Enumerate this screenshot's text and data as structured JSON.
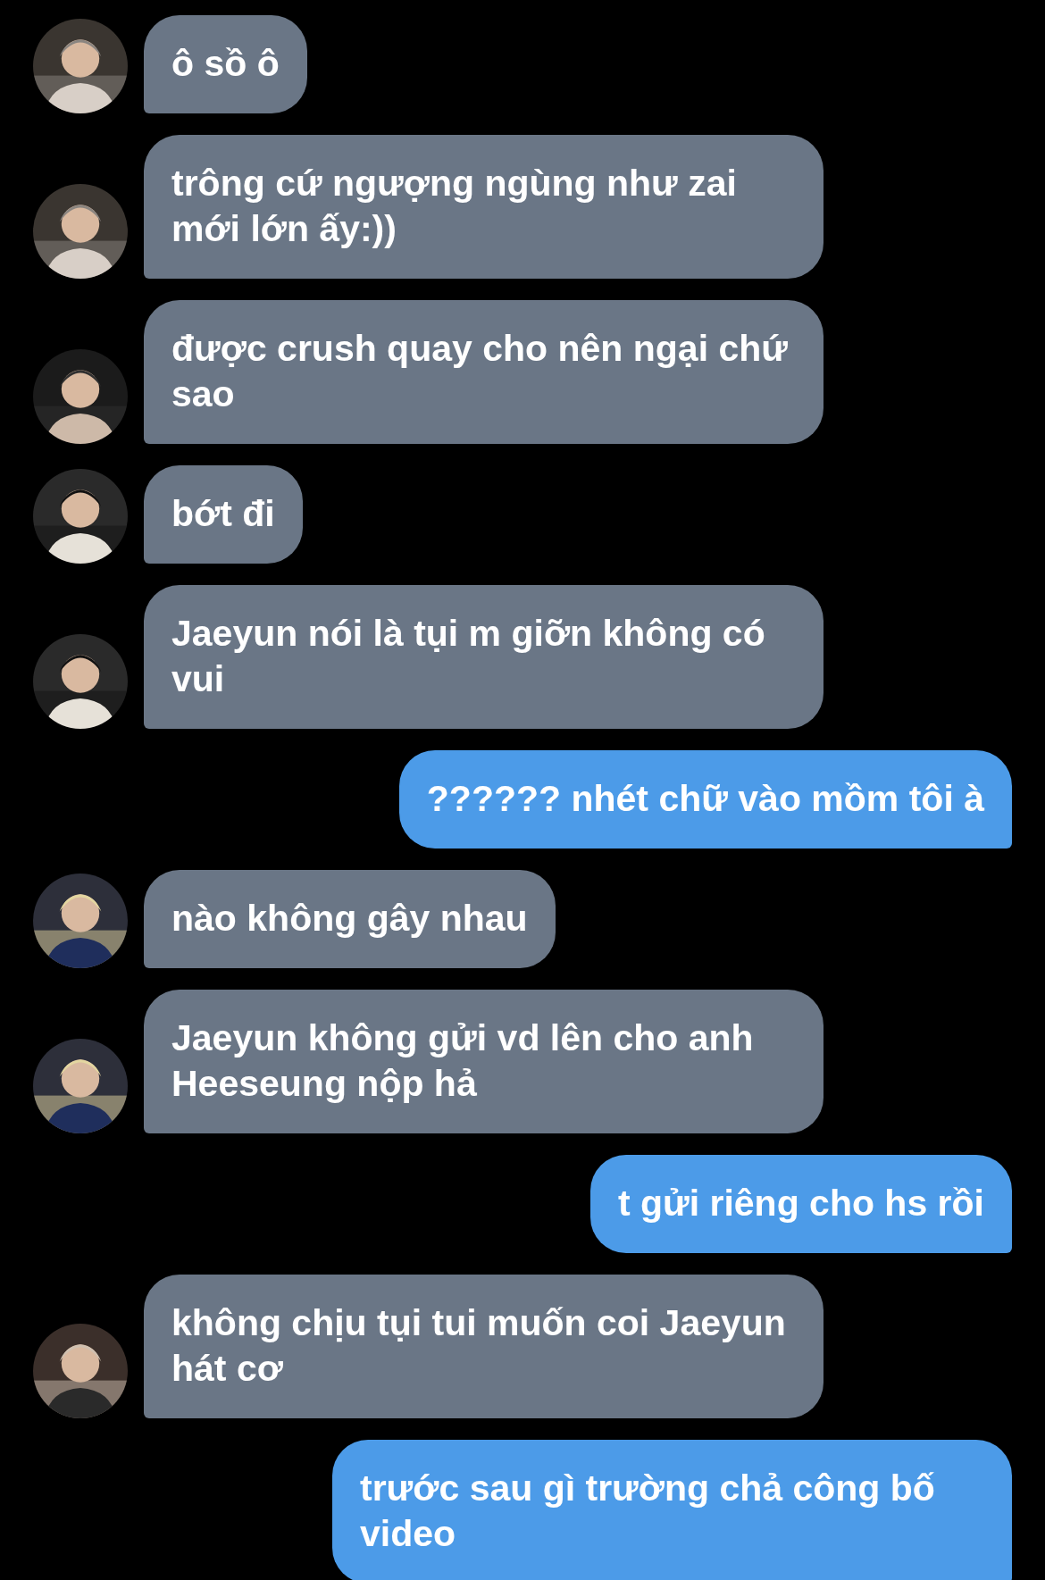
{
  "messages": [
    {
      "kind": "incoming",
      "text": "ô sồ ô"
    },
    {
      "kind": "incoming",
      "text": "trông cứ ngượng ngùng như zai mới lớn ấy:))"
    },
    {
      "kind": "incoming",
      "text": "được crush quay cho nên ngại chứ sao"
    },
    {
      "kind": "incoming",
      "text": "bớt đi"
    },
    {
      "kind": "incoming",
      "text": "Jaeyun nói là tụi m giỡn không có vui"
    },
    {
      "kind": "outgoing",
      "text": "?????? nhét chữ vào mồm tôi à"
    },
    {
      "kind": "incoming",
      "text": "nào không gây nhau"
    },
    {
      "kind": "incoming",
      "text": "Jaeyun không gửi vd lên cho anh Heeseung nộp hả"
    },
    {
      "kind": "outgoing",
      "text": "t gửi riêng cho hs rồi"
    },
    {
      "kind": "incoming",
      "text": "không chịu tụi tui muốn coi Jaeyun hát cơ"
    },
    {
      "kind": "outgoing",
      "text": "trước sau gì trường chả công bố video"
    }
  ]
}
